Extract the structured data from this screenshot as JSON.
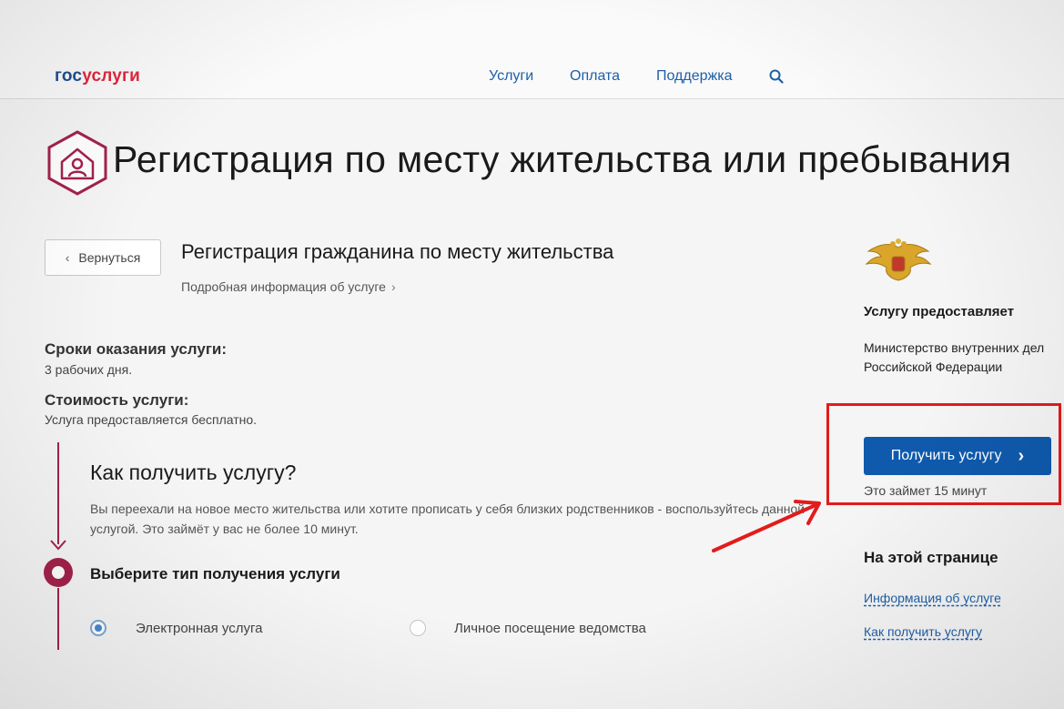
{
  "header": {
    "logo": {
      "part1": "гос",
      "part2": "услуги"
    },
    "nav": [
      "Услуги",
      "Оплата",
      "Поддержка"
    ],
    "search_icon": "search-icon"
  },
  "page": {
    "title": "Регистрация по месту жительства или пребывания",
    "title_icon": "house-person-icon"
  },
  "service": {
    "back_label": "Вернуться",
    "title": "Регистрация гражданина по месту жительства",
    "details_link": "Подробная информация об услуге",
    "term_label": "Сроки оказания услуги:",
    "term_value": "3 рабочих дня.",
    "cost_label": "Стоимость услуги:",
    "cost_value": "Услуга предоставляется бесплатно."
  },
  "how": {
    "title": "Как получить услугу?",
    "text": "Вы переехали на новое место жительства или хотите прописать у себя близких родственников - воспользуйтесь данной услугой. Это займёт у вас не более 10 минут.",
    "step_title": "Выберите тип получения услуги",
    "options": [
      {
        "label": "Электронная услуга",
        "selected": true
      },
      {
        "label": "Личное посещение ведомства",
        "selected": false
      }
    ]
  },
  "sidebar": {
    "emblem": "double-headed-eagle-emblem",
    "provider_heading": "Услугу предоставляет",
    "provider_name": "Министерство внутренних дел Российской Федерации",
    "get_button": "Получить услугу",
    "time_note": "Это займет 15 минут",
    "toc_heading": "На этой странице",
    "toc_links": [
      "Информация об услуге",
      "Как получить услугу"
    ]
  },
  "colors": {
    "brand_blue": "#0f5aad",
    "accent_burgundy": "#a3224b",
    "highlight_red": "#e31b1b",
    "link_blue": "#1d5fa8"
  }
}
